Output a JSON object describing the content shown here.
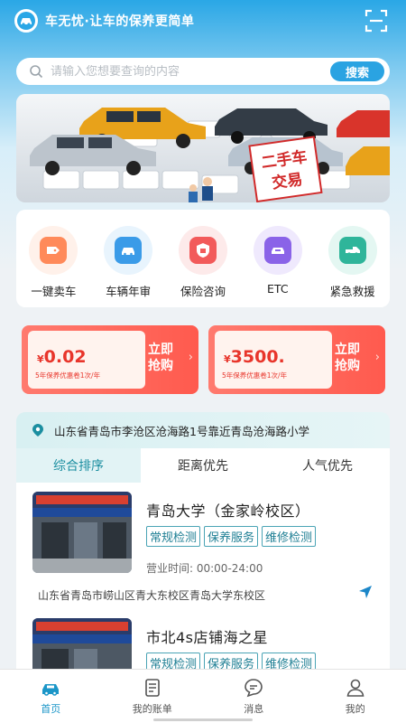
{
  "header": {
    "title": "车无忧·让车的保养更简单",
    "logo_icon": "car-logo-icon",
    "scan_icon": "scan-icon"
  },
  "search": {
    "placeholder": "请输入您想要查询的内容",
    "button_label": "搜索"
  },
  "banner": {
    "sign_line1": "二手车",
    "sign_line2": "交易"
  },
  "services": [
    {
      "label": "一键卖车",
      "icon": "sell-car-icon",
      "color": "#ff8a5a",
      "bg": "#fff1ea"
    },
    {
      "label": "车辆年审",
      "icon": "car-inspection-icon",
      "color": "#3a9be8",
      "bg": "#e8f4fd"
    },
    {
      "label": "保险咨询",
      "icon": "insurance-icon",
      "color": "#f25a5a",
      "bg": "#fdeaea"
    },
    {
      "label": "ETC",
      "icon": "etc-icon",
      "color": "#8a63e8",
      "bg": "#efe9fd"
    },
    {
      "label": "紧急救援",
      "icon": "rescue-icon",
      "color": "#2fb59a",
      "bg": "#e4f7f2"
    }
  ],
  "coupons": [
    {
      "yen": "¥",
      "price": "0.02",
      "desc": "5年保养优惠卷1次/年",
      "buy": "立即抢购"
    },
    {
      "yen": "¥",
      "price": "3500.",
      "desc": "5年保养优惠卷1次/年",
      "buy": "立即抢购"
    }
  ],
  "location": {
    "text": "山东省青岛市李沧区沧海路1号靠近青岛沧海路小学"
  },
  "tabs": [
    {
      "label": "综合排序",
      "active": true
    },
    {
      "label": "距离优先"
    },
    {
      "label": "人气优先"
    }
  ],
  "shops": [
    {
      "name": "青岛大学（金家岭校区）",
      "tags": [
        "常规检测",
        "保养服务",
        "维修检测"
      ],
      "hours": "营业时间:  00:00-24:00",
      "address": "山东省青岛市崂山区青大东校区青岛大学东校区"
    },
    {
      "name": "市北4s店铺海之星",
      "tags": [
        "常规检测",
        "保养服务",
        "维修检测"
      ]
    }
  ],
  "bottom_nav": [
    {
      "label": "首页",
      "icon": "home-icon",
      "active": true
    },
    {
      "label": "我的账单",
      "icon": "bill-icon"
    },
    {
      "label": "消息",
      "icon": "message-icon"
    },
    {
      "label": "我的",
      "icon": "user-icon"
    }
  ],
  "colors": {
    "accent": "#2aa3e2",
    "teal": "#1b8ea0",
    "coupon_red": "#ff5a4e"
  }
}
